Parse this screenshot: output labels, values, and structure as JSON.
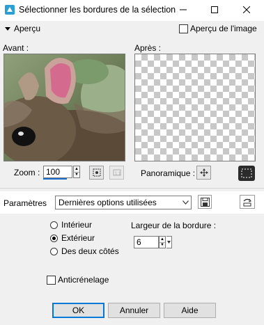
{
  "window": {
    "title": "Sélectionner les bordures de la sélection",
    "controls": {
      "minimize": "—",
      "maximize": "□",
      "close": "✕"
    }
  },
  "preview_header": {
    "label": "Aperçu",
    "checkbox_label": "Aperçu de l'image"
  },
  "preview": {
    "before_label": "Avant :",
    "after_label": "Après :",
    "zoom_label": "Zoom :",
    "zoom_value": "100",
    "pan_label": "Panoramique :"
  },
  "params": {
    "label": "Paramètres",
    "preset": "Dernières options utilisées"
  },
  "options": {
    "radios": [
      {
        "label": "Intérieur",
        "checked": false
      },
      {
        "label": "Extérieur",
        "checked": true
      },
      {
        "label": "Des deux côtés",
        "checked": false
      }
    ],
    "width_label": "Largeur de la bordure :",
    "width_value": "6",
    "antialias_label": "Anticrénelage"
  },
  "buttons": {
    "ok": "OK",
    "cancel": "Annuler",
    "help": "Aide"
  },
  "colors": {
    "accent": "#0078d7",
    "titlebar": "#ffffff",
    "dialog_bg": "#f0f0f0",
    "checker": "#c8c8c8"
  }
}
